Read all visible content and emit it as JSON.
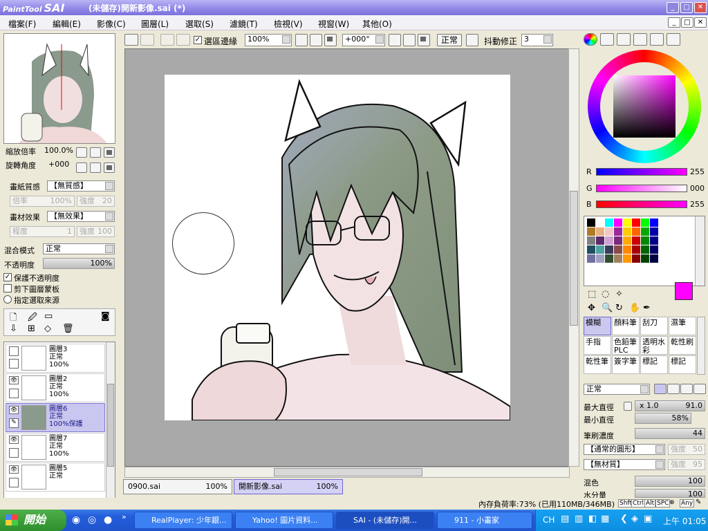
{
  "app": {
    "logo_small": "PaintTool",
    "logo_big": "SAI",
    "window_title": "(未儲存)開新影像.sai (*)"
  },
  "menu": [
    "檔案(F)",
    "編輯(E)",
    "影像(C)",
    "圖層(L)",
    "選取(S)",
    "濾鏡(T)",
    "檢視(V)",
    "視窗(W)",
    "其他(O)"
  ],
  "navigator": {
    "zoom_label": "縮放倍率",
    "zoom_value": "100.0%",
    "rotate_label": "旋轉角度",
    "rotate_value": "+000"
  },
  "paper": {
    "texture_label": "畫紙質感",
    "texture_value": "【無質感】",
    "rate_label": "倍率",
    "rate_value": "100%",
    "strength_label": "強度",
    "strength_value": "20",
    "effect_label": "畫材效果",
    "effect_value": "【無效果】",
    "degree_label": "程度",
    "degree_value": "1",
    "effect_strength_label": "強度",
    "effect_strength_value": "100"
  },
  "layer_props": {
    "blend_label": "混合模式",
    "blend_value": "正常",
    "opacity_label": "不透明度",
    "opacity_value": "100%",
    "opacity_fraction": 1.0,
    "preserve_opacity": "保護不透明度",
    "clip_mask": "剪下圖層蒙板",
    "selection_source": "指定選取來源"
  },
  "layers": [
    {
      "name": "圖層3",
      "mode": "正常",
      "opacity": "100%",
      "visible": false
    },
    {
      "name": "圖層2",
      "mode": "正常",
      "opacity": "100%",
      "visible": true
    },
    {
      "name": "圖層6",
      "mode": "正常",
      "opacity": "100%保護",
      "visible": true,
      "active": true
    },
    {
      "name": "圖層7",
      "mode": "正常",
      "opacity": "100%",
      "visible": true
    },
    {
      "name": "圖層5",
      "mode": "正常",
      "opacity": "",
      "visible": true
    }
  ],
  "toolbar": {
    "selection_edge": "選區邊緣",
    "zoom": "100%",
    "angle": "+000°",
    "blend": "正常",
    "stabilizer_label": "抖動修正",
    "stabilizer_value": "3"
  },
  "tabs": [
    {
      "name": "0900.sai",
      "zoom": "100%"
    },
    {
      "name": "開新影像.sai",
      "zoom": "100%"
    }
  ],
  "color": {
    "r_label": "R",
    "r_value": "255",
    "g_label": "G",
    "g_value": "000",
    "b_label": "B",
    "b_value": "255",
    "current": "#ff00ff",
    "palette": [
      "#000000",
      "#ffffff",
      "#00ffff",
      "#ff00ff",
      "#ffff00",
      "#ff0000",
      "#00ff00",
      "#0000ff",
      "#b07a2a",
      "#e8b080",
      "#f0c8c8",
      "#9c2a9c",
      "#ffcc00",
      "#ff6600",
      "#00aa00",
      "#0000aa",
      "#808080",
      "#5a2a6a",
      "#d0a0d0",
      "#7a2a7a",
      "#ffaa00",
      "#cc0000",
      "#008800",
      "#000088",
      "#205060",
      "#50a0a0",
      "#3a3a5a",
      "#8a4a4a",
      "#ff8800",
      "#aa0000",
      "#006600",
      "#000066",
      "#7070a0",
      "#a0a0c0",
      "#305030",
      "#a08060",
      "#ff9900",
      "#880000",
      "#004400",
      "#000044"
    ]
  },
  "tools": [
    "模糊",
    "顏料筆",
    "刮刀",
    "濕筆",
    "手指",
    "色鉛筆PLC",
    "透明水彩",
    "乾性刷",
    "乾性筆",
    "簽字筆",
    "標記",
    "標記"
  ],
  "brush": {
    "mode": "正常",
    "max_diameter_label": "最大直徑",
    "max_diameter_mult": "x 1.0",
    "max_diameter_value": "91.0",
    "min_diameter_label": "最小直徑",
    "min_diameter_value": "58%",
    "density_label": "筆刷濃度",
    "density_value": "44",
    "shape": "【通常的圓形】",
    "shape_strength_label": "強度",
    "shape_strength_value": "50",
    "texture": "【無材質】",
    "texture_strength_label": "強度",
    "texture_strength_value": "95",
    "mix_label": "混色",
    "mix_value": "100",
    "water_label": "水分量",
    "water_value": "100"
  },
  "status": {
    "memory": "內存負荷率:73% (已用110MB/346MB)",
    "keys": [
      "Shft",
      "Ctrl",
      "Alt",
      "SPC",
      "Any"
    ]
  },
  "taskbar": {
    "start": "開始",
    "tasks": [
      "RealPlayer: 少年銀...",
      "Yahoo! 圖片資料...",
      "SAI - (未儲存)開...",
      "911 - 小畫家"
    ],
    "lang": "CH",
    "clock": "上午 01:05"
  }
}
